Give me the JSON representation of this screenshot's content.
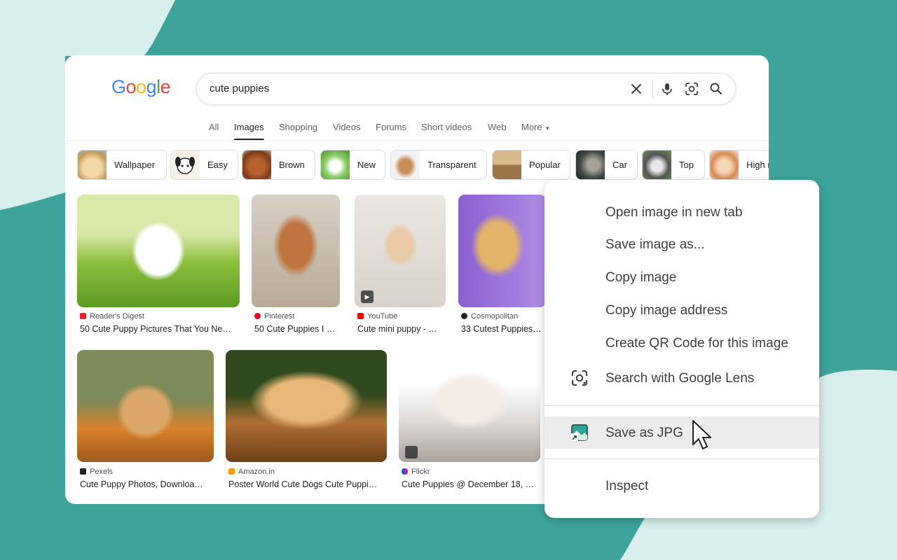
{
  "logo": [
    "G",
    "o",
    "o",
    "g",
    "l",
    "e"
  ],
  "search": {
    "query": "cute puppies",
    "icons": [
      "close-icon",
      "mic-icon",
      "lens-icon",
      "search-icon"
    ]
  },
  "tabs": [
    "All",
    "Images",
    "Shopping",
    "Videos",
    "Forums",
    "Short videos",
    "Web",
    "More"
  ],
  "active_tab": "Images",
  "chips": [
    "Wallpaper",
    "Easy",
    "Brown",
    "New",
    "Transparent",
    "Popular",
    "Car",
    "Top",
    "High r"
  ],
  "results": [
    {
      "source": "Reader's Digest",
      "title": "50 Cute Puppy Pictures That You Ne…"
    },
    {
      "source": "Pinterest",
      "title": "50 Cute Puppies I …"
    },
    {
      "source": "YouTube",
      "title": "Cute mini puppy - …"
    },
    {
      "source": "Cosmopolitan",
      "title": "33 Cutest Puppies …"
    },
    {
      "source": "Pexels",
      "title": "Cute Puppy Photos, Downloa…"
    },
    {
      "source": "Amazon.in",
      "title": "Poster World Cute Dogs Cute Puppi…"
    },
    {
      "source": "Flickr",
      "title": "Cute Puppies @ December 18, …"
    }
  ],
  "context_menu": {
    "items": [
      "Open image in new tab",
      "Save image as...",
      "Copy image",
      "Copy image address",
      "Create QR Code for this image",
      "Search with Google Lens",
      "Save as JPG",
      "Inspect"
    ],
    "highlighted": "Save as JPG"
  },
  "colors": {
    "background": "#3ea49b",
    "blob": "#d8efed",
    "lens": "#3c4043",
    "jpg_icon": "#2fa39a"
  }
}
